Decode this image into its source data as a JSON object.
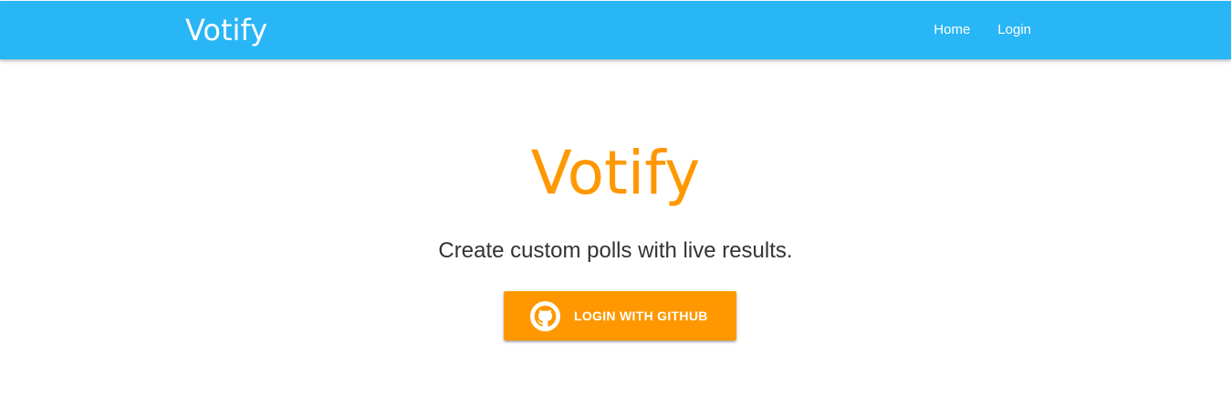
{
  "colors": {
    "navbar_bg": "#29b6f6",
    "accent": "#ff9800",
    "nav_text": "#ffffff",
    "subtitle_text": "#333333"
  },
  "navbar": {
    "brand": "Votify",
    "links": [
      {
        "label": "Home"
      },
      {
        "label": "Login"
      }
    ]
  },
  "hero": {
    "title": "Votify",
    "subtitle": "Create custom polls with live results.",
    "login_button": {
      "label": "LOGIN WITH GITHUB",
      "icon": "github-icon"
    }
  }
}
